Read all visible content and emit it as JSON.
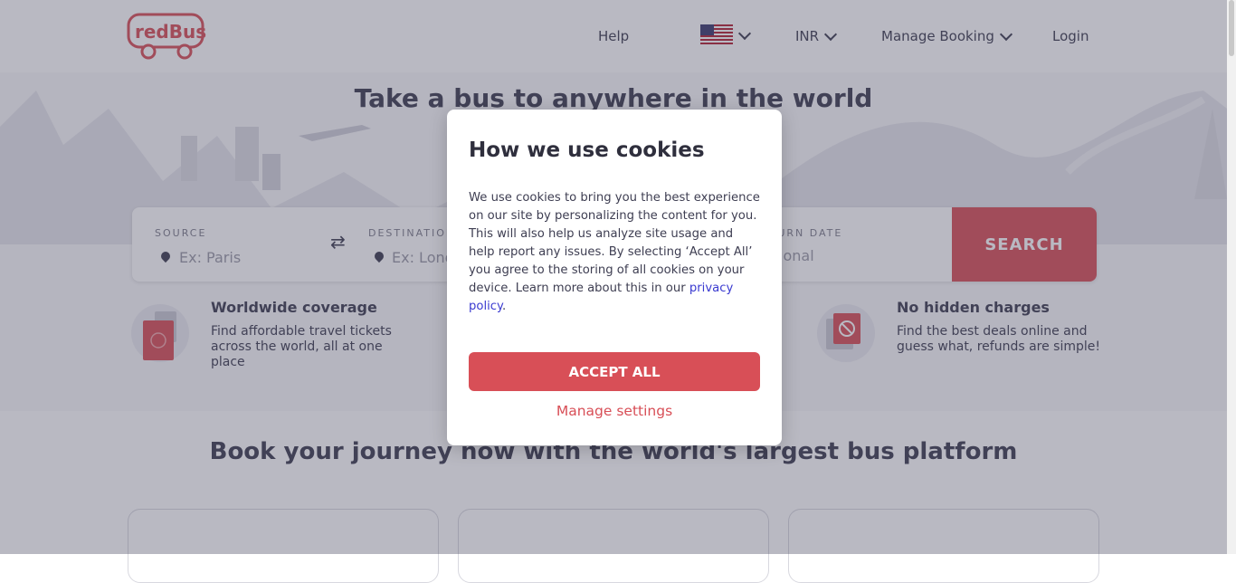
{
  "header": {
    "logo_text": "redBus",
    "nav": {
      "help": "Help",
      "currency": "INR",
      "manage_booking": "Manage Booking",
      "login": "Login"
    },
    "flag_icon": "us-flag-icon"
  },
  "hero": {
    "title": "Take a bus to anywhere in the world",
    "search": {
      "source_label": "SOURCE",
      "source_placeholder": "Ex: Paris",
      "destination_label": "DESTINATION",
      "destination_placeholder": "Ex: London",
      "return_label": "RETURN DATE",
      "return_placeholder": "Optional",
      "search_button": "SEARCH"
    },
    "features": [
      {
        "title": "Worldwide coverage",
        "desc": "Find affordable travel tickets across the world, all at one place"
      },
      {
        "title": "No hidden charges",
        "desc": "Find the best deals online and guess what, refunds are simple!"
      }
    ]
  },
  "section": {
    "title": "Book your journey now with the world's largest bus platform"
  },
  "cookie_modal": {
    "title": "How we use cookies",
    "body_text": "We use cookies to bring you the best experience on our site by personalizing the content for you. This will also help us analyze site usage and help report any issues. By selecting ‘Accept All’ you agree to the storing of all cookies on your device. Learn more about this in our ",
    "policy_link": "privacy policy",
    "body_end": ".",
    "accept_button": "ACCEPT ALL",
    "manage_link": "Manage settings"
  },
  "colors": {
    "brand_red": "#d84f57",
    "text_dark": "#3e3e52",
    "link_blue": "#3a3ad0"
  }
}
